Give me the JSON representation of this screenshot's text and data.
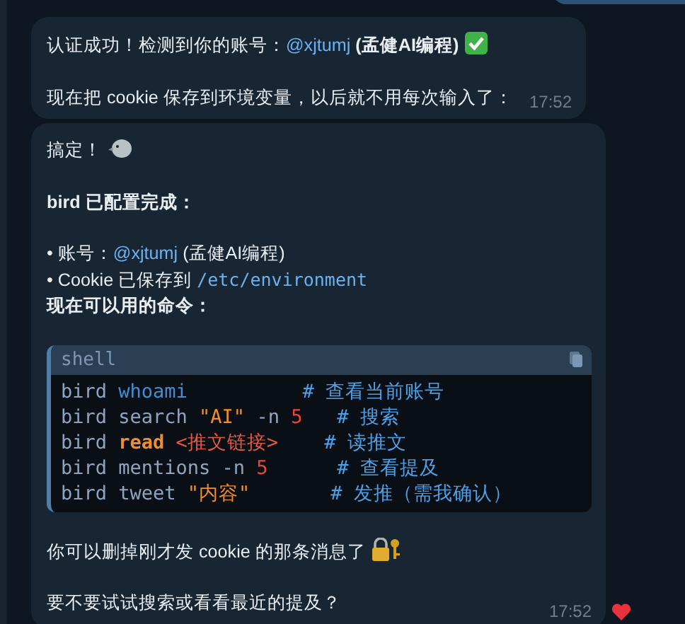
{
  "messages": [
    {
      "time": "17:52",
      "content": [
        {
          "kind": "paragraph",
          "lines": [
            {
              "bold": false,
              "segments": [
                {
                  "kind": "plain",
                  "text": "认证成功！检测到你的账号："
                },
                {
                  "kind": "mention",
                  "text": "@xjtumj"
                },
                {
                  "kind": "bold",
                  "text": " (孟健AI编程)"
                },
                {
                  "kind": "check-emoji"
                }
              ]
            }
          ]
        },
        {
          "kind": "paragraph",
          "lines": [
            {
              "bold": false,
              "segments": [
                {
                  "kind": "plain",
                  "text": "现在把 cookie 保存到环境变量，以后就不用每次输入了："
                }
              ]
            }
          ]
        }
      ]
    },
    {
      "time": "17:52",
      "content": [
        {
          "kind": "paragraph",
          "lines": [
            {
              "bold": false,
              "segments": [
                {
                  "kind": "plain",
                  "text": "搞定！"
                },
                {
                  "kind": "bird-emoji"
                }
              ]
            }
          ]
        },
        {
          "kind": "paragraph",
          "lines": [
            {
              "bold": true,
              "segments": [
                {
                  "kind": "plain",
                  "text": "bird 已配置完成："
                }
              ]
            }
          ]
        },
        {
          "kind": "paragraph",
          "lines": [
            {
              "bold": false,
              "segments": [
                {
                  "kind": "plain",
                  "text": "• 账号："
                },
                {
                  "kind": "mention",
                  "text": "@xjtumj"
                },
                {
                  "kind": "plain",
                  "text": " (孟健AI编程)"
                }
              ]
            },
            {
              "bold": false,
              "segments": [
                {
                  "kind": "plain",
                  "text": "• Cookie 已保存到 "
                },
                {
                  "kind": "code",
                  "text": "/etc/environment"
                }
              ]
            },
            {
              "bold": true,
              "segments": [
                {
                  "kind": "plain",
                  "text": "现在可以用的命令："
                }
              ]
            }
          ]
        },
        {
          "kind": "code",
          "language": "shell",
          "lines": [
            [
              {
                "kind": "plain",
                "text": "bird "
              },
              {
                "kind": "keyword",
                "text": "whoami          "
              },
              {
                "kind": "comment",
                "text": "# 查看当前账号"
              }
            ],
            [
              {
                "kind": "plain",
                "text": "bird search "
              },
              {
                "kind": "string",
                "text": "\"AI\""
              },
              {
                "kind": "plain",
                "text": " -n "
              },
              {
                "kind": "number",
                "text": "5   "
              },
              {
                "kind": "comment",
                "text": "# 搜索"
              }
            ],
            [
              {
                "kind": "plain",
                "text": "bird "
              },
              {
                "kind": "builtin",
                "text": "read "
              },
              {
                "kind": "placeholder",
                "text": "<推文链接>    "
              },
              {
                "kind": "comment",
                "text": "# 读推文"
              }
            ],
            [
              {
                "kind": "plain",
                "text": "bird mentions -n "
              },
              {
                "kind": "number",
                "text": "5      "
              },
              {
                "kind": "comment",
                "text": "# 查看提及"
              }
            ],
            [
              {
                "kind": "plain",
                "text": "bird tweet "
              },
              {
                "kind": "string",
                "text": "\"内容\"       "
              },
              {
                "kind": "comment",
                "text": "# 发推（需我确认）"
              }
            ]
          ]
        },
        {
          "kind": "paragraph",
          "lines": [
            {
              "bold": false,
              "segments": [
                {
                  "kind": "plain",
                  "text": "你可以删掉刚才发 cookie 的那条消息了"
                },
                {
                  "kind": "lock-emoji"
                }
              ]
            }
          ]
        },
        {
          "kind": "paragraph",
          "lines": [
            {
              "bold": false,
              "segments": [
                {
                  "kind": "plain",
                  "text": "要不要试试搜索或看看最近的提及？"
                }
              ]
            }
          ]
        }
      ]
    }
  ]
}
